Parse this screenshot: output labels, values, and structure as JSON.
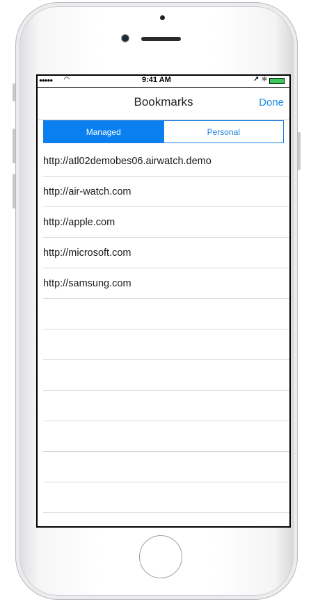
{
  "status_bar": {
    "signal": "●●●●●",
    "wifi_icon": "wifi-icon",
    "time": "9:41 AM",
    "location_icon": "location-arrow-icon",
    "bluetooth_icon": "bluetooth-icon",
    "battery_icon": "battery-icon",
    "battery_color": "#3cc95c"
  },
  "nav": {
    "title": "Bookmarks",
    "done_label": "Done",
    "accent_color": "#1a8ae6"
  },
  "segments": {
    "managed": "Managed",
    "personal": "Personal",
    "selected": "Managed"
  },
  "bookmarks": [
    "http://atl02demobes06.airwatch.demo",
    "http://air-watch.com",
    "http://apple.com",
    "http://microsoft.com",
    "http://samsung.com"
  ]
}
